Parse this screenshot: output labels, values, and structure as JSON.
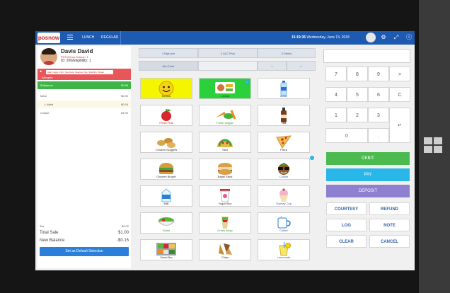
{
  "topbar": {
    "logo": "posnow",
    "nav": [
      "LUNCH",
      "REGULAR"
    ],
    "time": "15:19:36",
    "date": "Wednesday, June 13, 2018",
    "icons": [
      "user-icon",
      "gear-icon",
      "expand-icon",
      "info-icon"
    ]
  },
  "patron": {
    "name": "Davis David",
    "school": "PCS Demo School / 1",
    "id_line": "ID: 200/Eligibility: 1",
    "allergies": "Dairy, Eggs, Fish, Tree Nuts, Peanuts, Soy, Shellfish, Wheat",
    "allergies_label": "Allergies"
  },
  "account": {
    "balance_label": "$ Balance",
    "balance_value": "$0.85",
    "meal_label": "Meal",
    "meal_value": "$0.00",
    "lmeal_label": "L-Meal",
    "lmeal_value": "$0.00",
    "cookie_label": "Cookie",
    "cookie_value": "$1.00",
    "tax_label": "Tax",
    "tax_value": "$0.00",
    "total_label": "Total Sale",
    "total_value": "$1.00",
    "newbal_label": "New Balance",
    "newbal_value": "-$0.15",
    "default_button": "Set as Default Selection"
  },
  "tabs": {
    "row1": [
      "1 Mylunch",
      "2 ALC Prck",
      "3 Drinks"
    ],
    "row2": [
      "Ala Carte",
      "",
      "<",
      ">"
    ]
  },
  "items": [
    [
      "",
      "L-Meal",
      "Water"
    ],
    [
      "Fresh Fruit",
      "Fresh Veggie",
      "Tea"
    ],
    [
      "Chicken Nuggets",
      "Taco",
      "Pizza"
    ],
    [
      "Chicken Burger",
      "Bagel Sand",
      "Cookie"
    ],
    [
      "Milk",
      "Yogurt 8oz",
      "Sunday Cup"
    ],
    [
      "Salad",
      "Greek Wrap",
      "Coffee"
    ],
    [
      "Salad Bar",
      "Chips",
      "Lemonade"
    ]
  ],
  "tile_first": "$-Meal",
  "keypad": {
    "rows": [
      [
        "7",
        "8",
        "9",
        ">"
      ],
      [
        "4",
        "5",
        "6",
        "C"
      ],
      [
        "1",
        "2",
        "3",
        ""
      ],
      [
        "0",
        ".",
        "↵"
      ]
    ]
  },
  "actions": {
    "debit": "DEBIT",
    "pay": "PAY",
    "deposit": "DEPOSIT",
    "courtesy": "COURTESY",
    "refund": "REFUND",
    "log": "LOG",
    "note": "NOTE",
    "clear": "CLEAR",
    "cancel": "CANCEL"
  },
  "colors": {
    "topbar": "#1d5ab2",
    "balance": "#3fb449",
    "allergy": "#e8565a",
    "debit": "#4cbb4f",
    "pay": "#29b6e8",
    "deposit": "#8e7fd0"
  }
}
